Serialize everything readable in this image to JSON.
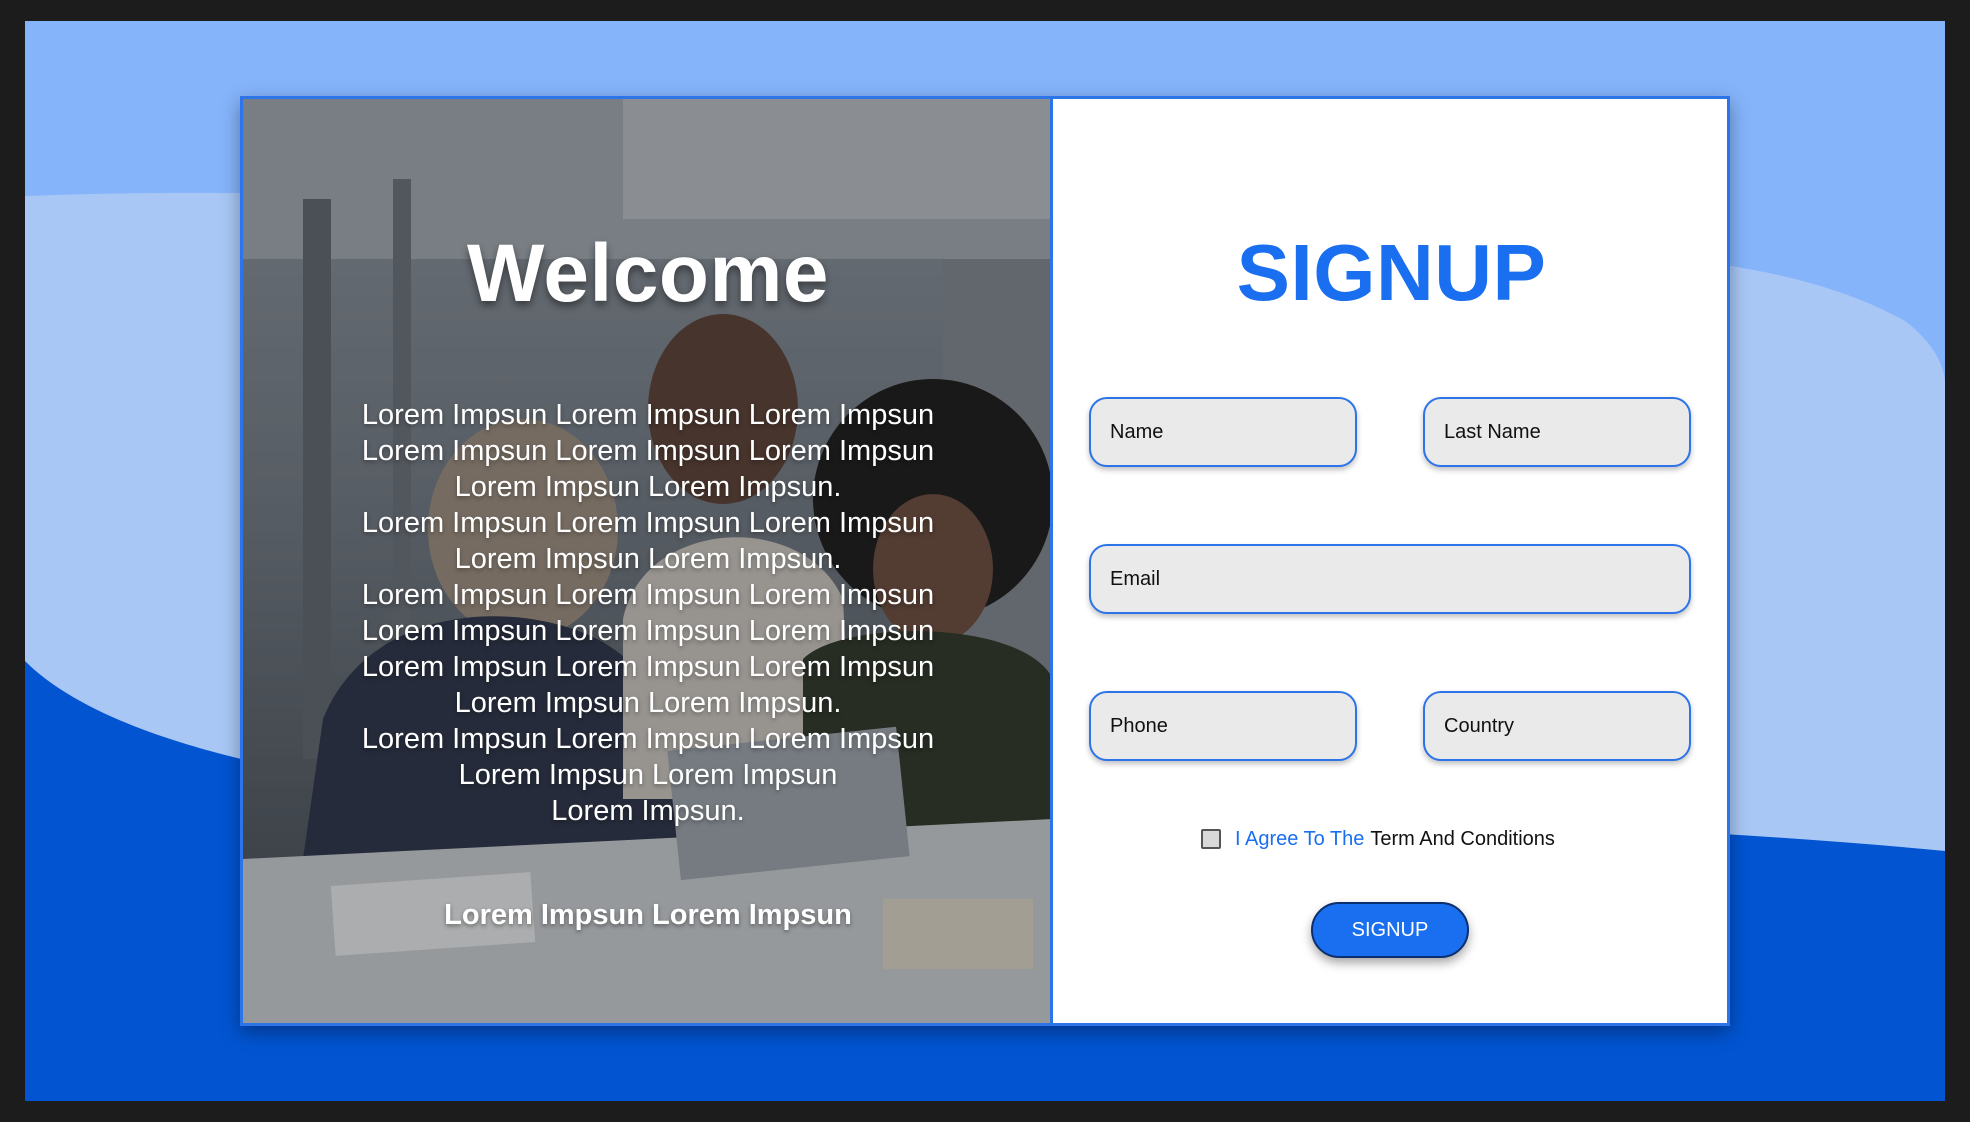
{
  "colors": {
    "page_background": "#1c1c1c",
    "light_blue": "#85b4fb",
    "mid_blue": "#a8c7f5",
    "deep_blue": "#0254d1",
    "accent": "#1a6ff0",
    "field_bg": "#eaeaea"
  },
  "welcome": {
    "title": "Welcome",
    "lines": [
      "Lorem Impsun Lorem Impsun Lorem Impsun",
      "Lorem Impsun Lorem Impsun Lorem Impsun",
      "Lorem Impsun Lorem Impsun.",
      "Lorem Impsun Lorem Impsun Lorem Impsun",
      "Lorem Impsun Lorem Impsun.",
      "Lorem Impsun Lorem Impsun Lorem Impsun",
      "Lorem Impsun Lorem Impsun Lorem Impsun",
      "Lorem Impsun Lorem Impsun Lorem Impsun",
      "Lorem Impsun Lorem Impsun.",
      "Lorem Impsun Lorem Impsun Lorem Impsun",
      "Lorem Impsun Lorem Impsun",
      "Lorem Impsun."
    ],
    "footer": "Lorem Impsun Lorem Impsun"
  },
  "signup": {
    "title": "SIGNUP",
    "fields": {
      "name": "Name",
      "last_name": "Last Name",
      "email": "Email",
      "phone": "Phone",
      "country": "Country"
    },
    "agree_prefix": "I Agree To The",
    "agree_link": "Term And Conditions",
    "button": "SIGNUP"
  }
}
